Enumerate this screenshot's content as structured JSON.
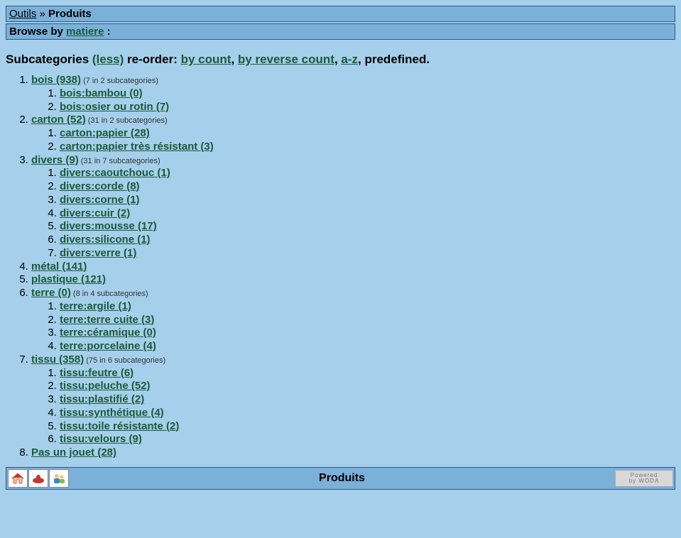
{
  "breadcrumb": {
    "root": "Outils",
    "sep": " » ",
    "current": "Produits"
  },
  "browse": {
    "prefix": "Browse by ",
    "field": "matiere",
    "suffix": " :"
  },
  "subcat_header": {
    "label": "Subcategories ",
    "less": "(less)",
    "reorder_label": " re-order: ",
    "by_count": "by count",
    "by_reverse": "by reverse count",
    "az": "a-z",
    "predefined": ", predefined."
  },
  "cats": [
    {
      "label": "bois (938)",
      "note": "(7 in 2 subcategories)",
      "subs": [
        {
          "label": "bois:bambou (0)"
        },
        {
          "label": "bois:osier ou rotin (7)"
        }
      ]
    },
    {
      "label": "carton (52)",
      "note": "(31 in 2 subcategories)",
      "subs": [
        {
          "label": "carton:papier (28)"
        },
        {
          "label": "carton:papier très résistant (3)"
        }
      ]
    },
    {
      "label": "divers (9)",
      "note": "(31 in 7 subcategories)",
      "subs": [
        {
          "label": "divers:caoutchouc (1)"
        },
        {
          "label": "divers:corde (8)"
        },
        {
          "label": "divers:corne (1)"
        },
        {
          "label": "divers:cuir (2)"
        },
        {
          "label": "divers:mousse (17)"
        },
        {
          "label": "divers:silicone (1)"
        },
        {
          "label": "divers:verre (1)"
        }
      ]
    },
    {
      "label": "métal (141)",
      "note": "",
      "subs": []
    },
    {
      "label": "plastique (121)",
      "note": "",
      "subs": []
    },
    {
      "label": "terre (0)",
      "note": "(8 in 4 subcategories)",
      "subs": [
        {
          "label": "terre:argile (1)"
        },
        {
          "label": "terre:terre cuite (3)"
        },
        {
          "label": "terre:céramique (0)"
        },
        {
          "label": "terre:porcelaine (4)"
        }
      ]
    },
    {
      "label": "tissu (358)",
      "note": "(75 in 6 subcategories)",
      "subs": [
        {
          "label": "tissu:feutre (6)"
        },
        {
          "label": "tissu:peluche (52)"
        },
        {
          "label": "tissu:plastifié (2)"
        },
        {
          "label": "tissu:synthétique (4)"
        },
        {
          "label": "tissu:toile résistante (2)"
        },
        {
          "label": "tissu:velours (9)"
        }
      ]
    },
    {
      "label": "Pas un jouet (28)",
      "note": "",
      "subs": []
    }
  ],
  "footer": {
    "title": "Produits",
    "powered1": "Powered",
    "powered2": "by WODA"
  }
}
